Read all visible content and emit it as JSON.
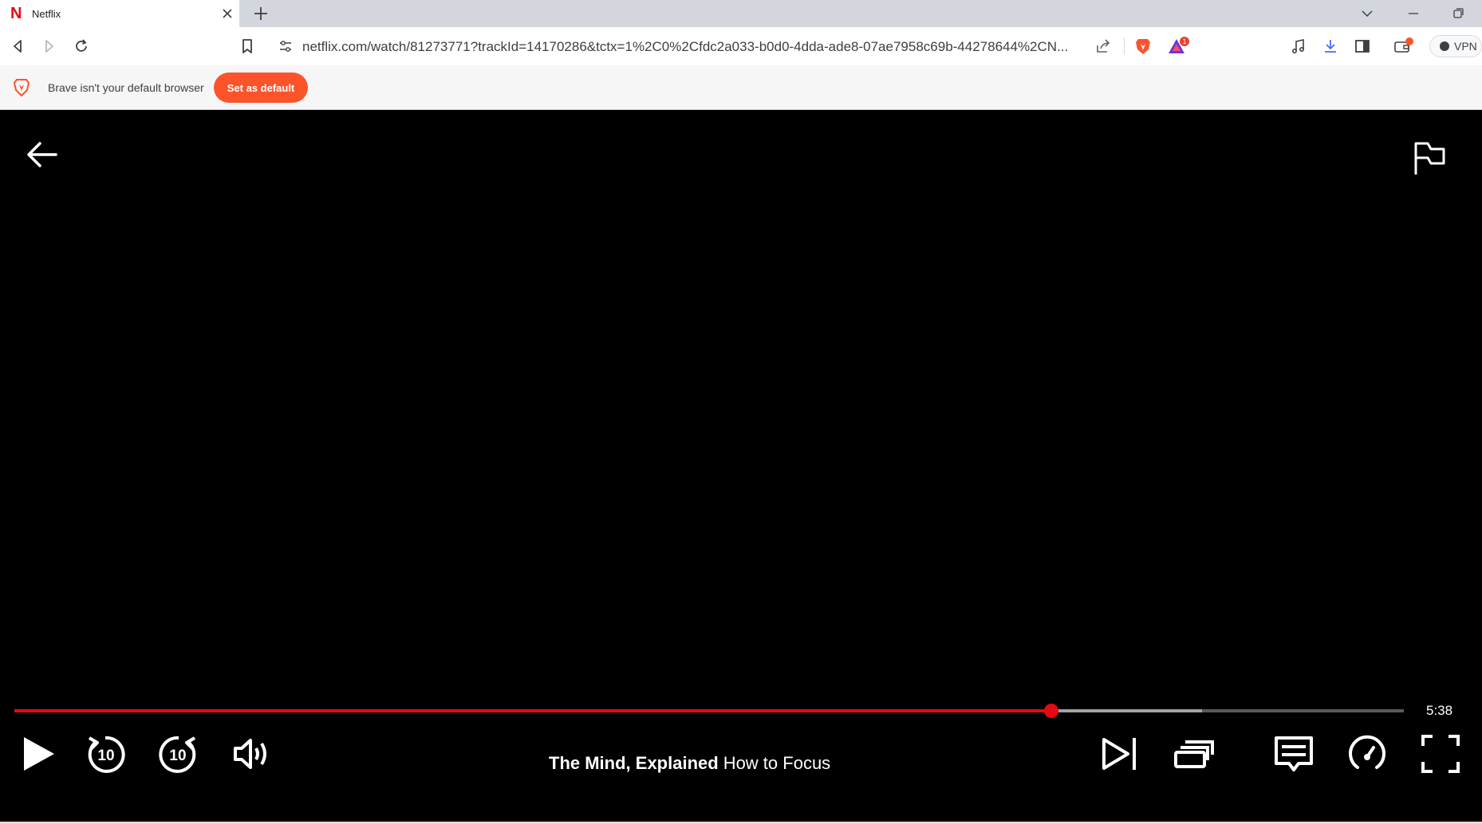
{
  "browser": {
    "tab": {
      "title": "Netflix",
      "favicon": "netflix-n-icon"
    },
    "url": "netflix.com/watch/81273771?trackId=14170286&tctx=1%2C0%2Cfdc2a033-b0d0-4dda-ade8-07ae7958c69b-44278644%2CN...",
    "rewards_badge": "1",
    "vpn_label": "VPN",
    "icons": [
      "back-icon",
      "forward-icon",
      "reload-icon",
      "bookmark-icon",
      "site-info-icon",
      "share-icon",
      "brave-shields-icon",
      "brave-rewards-icon",
      "media-icon",
      "download-icon",
      "sidebar-icon",
      "wallet-icon"
    ]
  },
  "infobar": {
    "message": "Brave isn't your default browser",
    "button_label": "Set as default"
  },
  "player": {
    "time_remaining": "5:38",
    "progress_fraction": 0.746,
    "buffer_fraction": 0.855,
    "show_title": "The Mind, Explained",
    "episode_title": "How to Focus",
    "colors": {
      "accent": "#e50914",
      "brave": "#fb542b"
    }
  }
}
